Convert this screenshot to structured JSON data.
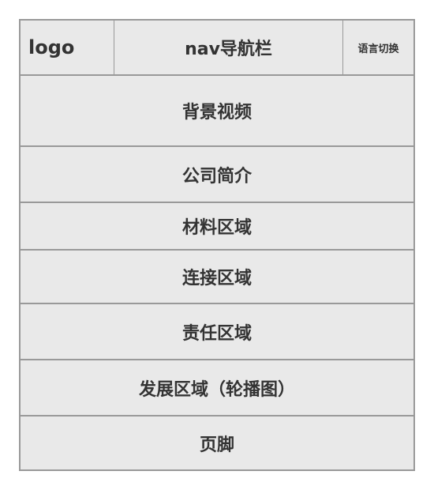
{
  "header": {
    "logo": "logo",
    "nav": "nav导航栏",
    "lang": "语言切换"
  },
  "sections": [
    "背景视频",
    "公司简介",
    "材料区域",
    "连接区域",
    "责任区域",
    "发展区域（轮播图）",
    "页脚"
  ]
}
